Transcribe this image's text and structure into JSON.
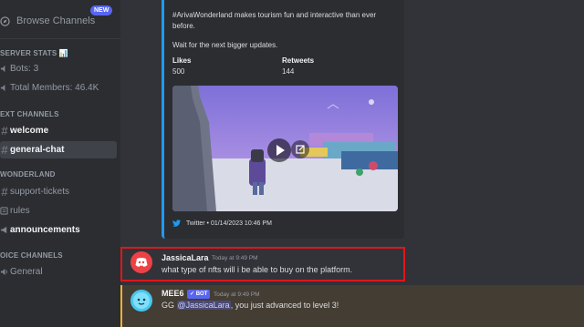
{
  "sidebar": {
    "browse": {
      "label": "Browse Channels",
      "badge": "NEW",
      "icon": "compass-icon"
    },
    "categories": {
      "server_stats": "SERVER STATS 📊",
      "text_channels": "EXT CHANNELS",
      "wonderland": "WONDERLAND",
      "voice_channels": "OICE CHANNELS"
    },
    "stats": {
      "bots": "Bots: 3",
      "members": "Total Members: 46.4K"
    },
    "channels": {
      "welcome": "welcome",
      "general_chat": "general-chat",
      "support_tickets": "support-tickets",
      "rules": "rules",
      "announcements": "announcements",
      "general_voice": "General"
    }
  },
  "embed": {
    "line1": "#ArivaWonderland makes tourism fun and interactive than ever",
    "line2": "before.",
    "line3": "Wait for the next bigger updates.",
    "likes_label": "Likes",
    "likes_value": "500",
    "retweets_label": "Retweets",
    "retweets_value": "144",
    "footer": "Twitter • 01/14/2023 10:46 PM",
    "accent_color": "#1d9bf0"
  },
  "messages": {
    "jessica": {
      "author": "JassicaLara",
      "timestamp": "Today at 9:49 PM",
      "text": "what type of nfts will i be able to buy on the platform."
    },
    "mee6": {
      "author": "MEE6",
      "badge": "✓ BOT",
      "timestamp": "Today at 9:49 PM",
      "prefix": "GG ",
      "mention": "@JassicaLara",
      "suffix": ", you just advanced to level 3!"
    }
  },
  "colors": {
    "highlight_border": "#e0161c",
    "mention_bar": "#f0b232",
    "blurple": "#5865f2"
  }
}
